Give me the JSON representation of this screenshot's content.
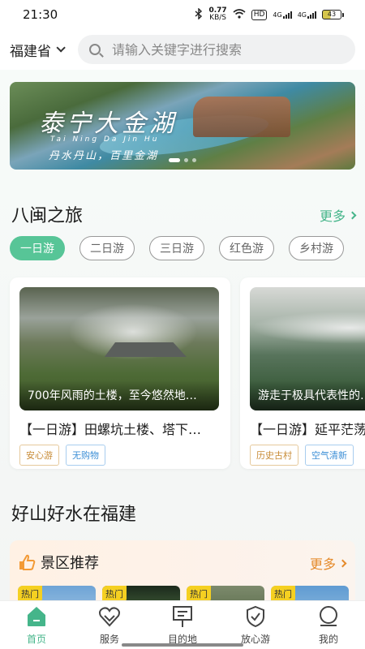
{
  "status_bar": {
    "time": "21:30",
    "net_speed_value": "0.77",
    "net_speed_unit": "KB/S",
    "hd_label": "HD",
    "sig1_label": "4G",
    "sig2_label": "4G",
    "battery": "43"
  },
  "header": {
    "province": "福建省",
    "search_placeholder": "请输入关键字进行搜索"
  },
  "banner": {
    "title": "泰宁大金湖",
    "pinyin": "Tai Ning Da Jin Hu",
    "slogan": "丹水丹山，百里金湖"
  },
  "tour_section": {
    "title": "八闽之旅",
    "more": "更多",
    "tabs": [
      "一日游",
      "二日游",
      "三日游",
      "红色游",
      "乡村游"
    ],
    "active_tab": 0,
    "cards": [
      {
        "caption": "700年风雨的土楼，至今悠然地…",
        "name": "【一日游】田螺坑土楼、塔下…",
        "tags": [
          "安心游",
          "无购物"
        ]
      },
      {
        "caption": "游走于极具代表性的…",
        "name": "【一日游】延平茫荡…",
        "tags": [
          "历史古村",
          "空气清新"
        ]
      }
    ]
  },
  "scenery_section": {
    "title": "好山好水在福建"
  },
  "recommend": {
    "title": "景区推荐",
    "more": "更多",
    "badges": [
      "热门",
      "热门",
      "热门",
      "热门"
    ]
  },
  "tabbar": {
    "items": [
      "首页",
      "服务",
      "目的地",
      "放心游",
      "我的"
    ],
    "active": 0,
    "accent": "#45b58a"
  }
}
